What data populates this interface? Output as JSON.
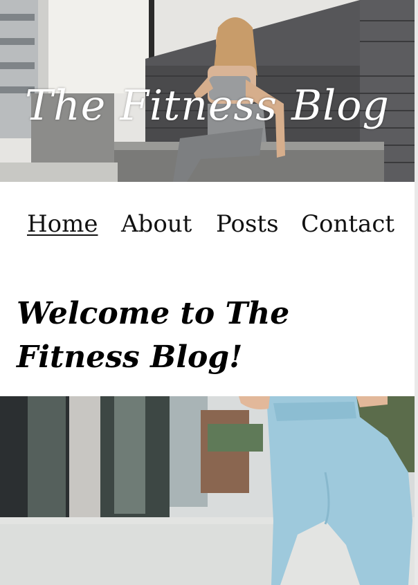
{
  "hero": {
    "title": "The Fitness Blog"
  },
  "nav": {
    "items": [
      {
        "label": "Home",
        "active": true
      },
      {
        "label": "About",
        "active": false
      },
      {
        "label": "Posts",
        "active": false
      },
      {
        "label": "Contact",
        "active": false
      }
    ]
  },
  "main": {
    "welcome_heading": "Welcome to The Fitness Blog!"
  },
  "colors": {
    "page_background": "#ffffff",
    "text": "#111111",
    "hero_stone": "#4a4a4c",
    "leggings_blue": "#9ec9dc"
  }
}
